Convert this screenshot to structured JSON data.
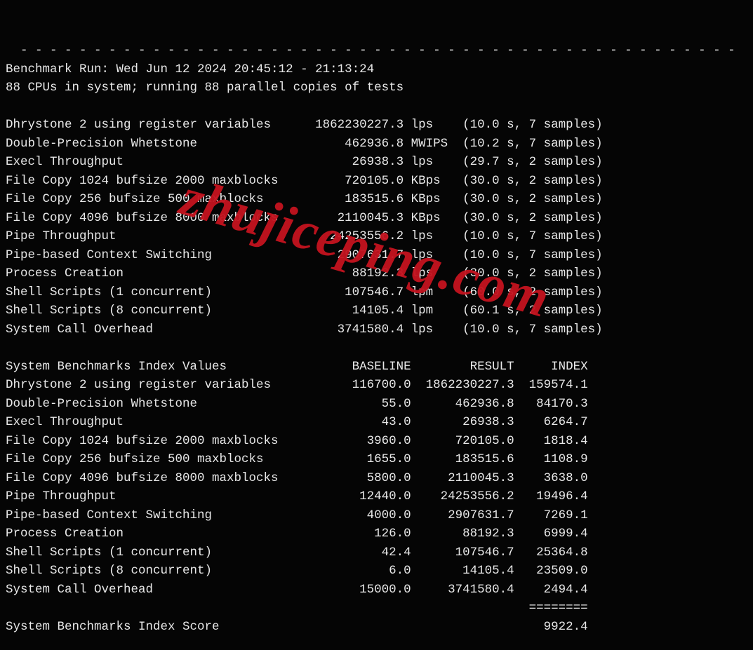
{
  "watermark": "zhujiceping.com",
  "divider": "- - - - - - - - - - - - - - - - - - - - - - - - - - - - - - - - - - - - - - - - - - - - - - - - - ",
  "header": {
    "run": "Benchmark Run: Wed Jun 12 2024 20:45:12 - 21:13:24",
    "cpus": "88 CPUs in system; running 88 parallel copies of tests"
  },
  "tests": [
    {
      "name": "Dhrystone 2 using register variables",
      "value": "1862230227.3",
      "unit": "lps",
      "timing": "(10.0 s, 7 samples)"
    },
    {
      "name": "Double-Precision Whetstone",
      "value": "462936.8",
      "unit": "MWIPS",
      "timing": "(10.2 s, 7 samples)"
    },
    {
      "name": "Execl Throughput",
      "value": "26938.3",
      "unit": "lps",
      "timing": "(29.7 s, 2 samples)"
    },
    {
      "name": "File Copy 1024 bufsize 2000 maxblocks",
      "value": "720105.0",
      "unit": "KBps",
      "timing": "(30.0 s, 2 samples)"
    },
    {
      "name": "File Copy 256 bufsize 500 maxblocks",
      "value": "183515.6",
      "unit": "KBps",
      "timing": "(30.0 s, 2 samples)"
    },
    {
      "name": "File Copy 4096 bufsize 8000 maxblocks",
      "value": "2110045.3",
      "unit": "KBps",
      "timing": "(30.0 s, 2 samples)"
    },
    {
      "name": "Pipe Throughput",
      "value": "24253556.2",
      "unit": "lps",
      "timing": "(10.0 s, 7 samples)"
    },
    {
      "name": "Pipe-based Context Switching",
      "value": "2907631.7",
      "unit": "lps",
      "timing": "(10.0 s, 7 samples)"
    },
    {
      "name": "Process Creation",
      "value": "88192.3",
      "unit": "lps",
      "timing": "(30.0 s, 2 samples)"
    },
    {
      "name": "Shell Scripts (1 concurrent)",
      "value": "107546.7",
      "unit": "lpm",
      "timing": "(60.0 s, 2 samples)"
    },
    {
      "name": "Shell Scripts (8 concurrent)",
      "value": "14105.4",
      "unit": "lpm",
      "timing": "(60.1 s, 2 samples)"
    },
    {
      "name": "System Call Overhead",
      "value": "3741580.4",
      "unit": "lps",
      "timing": "(10.0 s, 7 samples)"
    }
  ],
  "indexHeader": {
    "title": "System Benchmarks Index Values",
    "c1": "BASELINE",
    "c2": "RESULT",
    "c3": "INDEX"
  },
  "index": [
    {
      "name": "Dhrystone 2 using register variables",
      "baseline": "116700.0",
      "result": "1862230227.3",
      "index": "159574.1"
    },
    {
      "name": "Double-Precision Whetstone",
      "baseline": "55.0",
      "result": "462936.8",
      "index": "84170.3"
    },
    {
      "name": "Execl Throughput",
      "baseline": "43.0",
      "result": "26938.3",
      "index": "6264.7"
    },
    {
      "name": "File Copy 1024 bufsize 2000 maxblocks",
      "baseline": "3960.0",
      "result": "720105.0",
      "index": "1818.4"
    },
    {
      "name": "File Copy 256 bufsize 500 maxblocks",
      "baseline": "1655.0",
      "result": "183515.6",
      "index": "1108.9"
    },
    {
      "name": "File Copy 4096 bufsize 8000 maxblocks",
      "baseline": "5800.0",
      "result": "2110045.3",
      "index": "3638.0"
    },
    {
      "name": "Pipe Throughput",
      "baseline": "12440.0",
      "result": "24253556.2",
      "index": "19496.4"
    },
    {
      "name": "Pipe-based Context Switching",
      "baseline": "4000.0",
      "result": "2907631.7",
      "index": "7269.1"
    },
    {
      "name": "Process Creation",
      "baseline": "126.0",
      "result": "88192.3",
      "index": "6999.4"
    },
    {
      "name": "Shell Scripts (1 concurrent)",
      "baseline": "42.4",
      "result": "107546.7",
      "index": "25364.8"
    },
    {
      "name": "Shell Scripts (8 concurrent)",
      "baseline": "6.0",
      "result": "14105.4",
      "index": "23509.0"
    },
    {
      "name": "System Call Overhead",
      "baseline": "15000.0",
      "result": "3741580.4",
      "index": "2494.4"
    }
  ],
  "separator": "========",
  "score": {
    "label": "System Benchmarks Index Score",
    "value": "9922.4"
  }
}
